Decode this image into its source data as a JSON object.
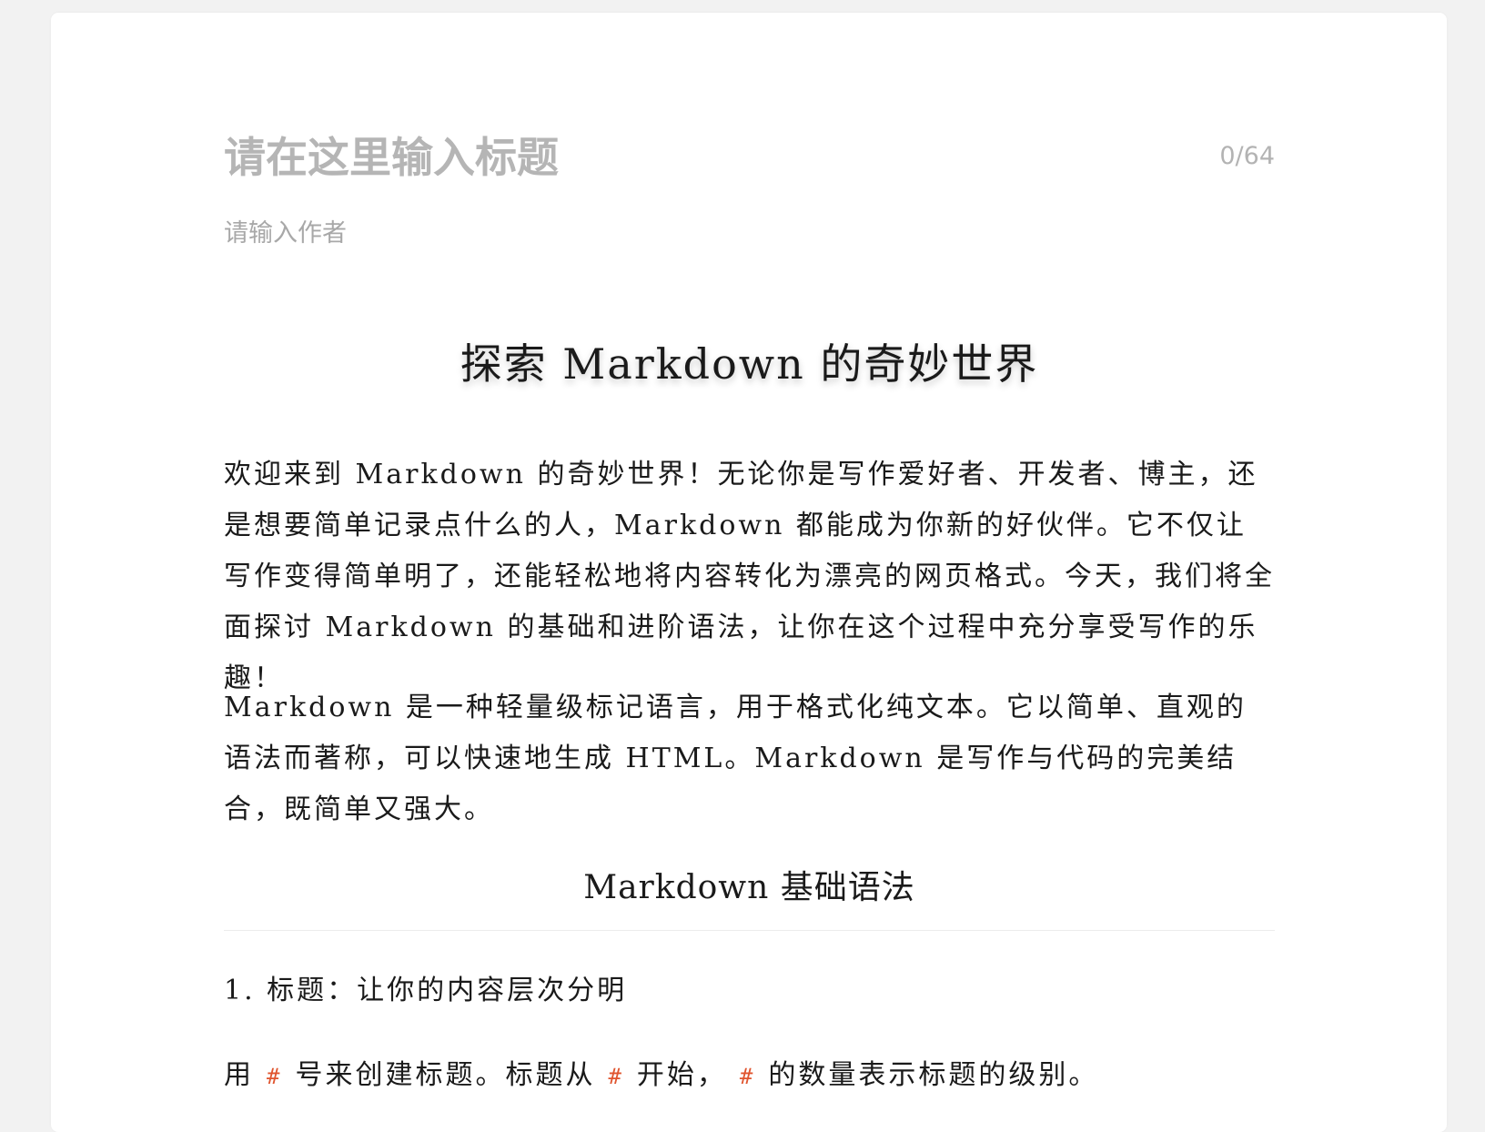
{
  "editor": {
    "title_placeholder": "请在这里输入标题",
    "title_counter": "0/64",
    "author_placeholder": "请输入作者"
  },
  "article": {
    "heading1": "探索 Markdown 的奇妙世界",
    "paragraph1": "欢迎来到 Markdown 的奇妙世界！无论你是写作爱好者、开发者、博主，还是想要简单记录点什么的人，Markdown 都能成为你新的好伙伴。它不仅让写作变得简单明了，还能轻松地将内容转化为漂亮的网页格式。今天，我们将全面探讨 Markdown 的基础和进阶语法，让你在这个过程中充分享受写作的乐趣！",
    "paragraph2": "Markdown 是一种轻量级标记语言，用于格式化纯文本。它以简单、直观的语法而著称，可以快速地生成 HTML。Markdown 是写作与代码的完美结合，既简单又强大。",
    "heading2": "Markdown 基础语法",
    "heading3": "1. 标题：让你的内容层次分明",
    "paragraph3": {
      "part1": "用",
      "code1": "#",
      "part2": "号来创建标题。标题从",
      "code2": "#",
      "part3": "开始，",
      "code3": "#",
      "part4": "的数量表示标题的级别。"
    }
  },
  "colors": {
    "background": "#f2f2f2",
    "card": "#ffffff",
    "placeholder": "#b5b5b5",
    "inline_code": "#e0552f"
  }
}
